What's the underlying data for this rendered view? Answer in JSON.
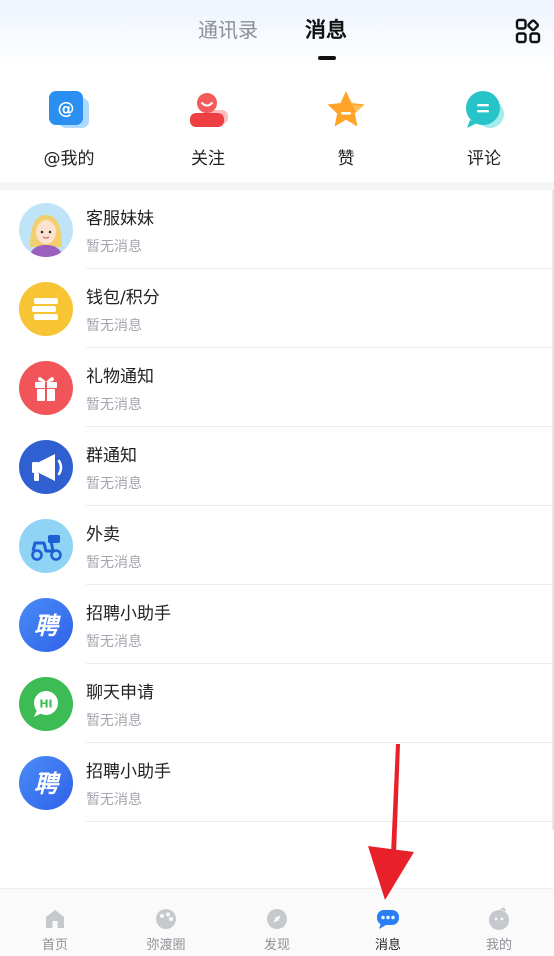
{
  "header": {
    "tabs": [
      {
        "label": "通讯录"
      },
      {
        "label": "消息"
      }
    ]
  },
  "quick_actions": [
    {
      "label": "@我的",
      "icon": "at-mention-icon"
    },
    {
      "label": "关注",
      "icon": "follow-person-icon"
    },
    {
      "label": "赞",
      "icon": "star-like-icon"
    },
    {
      "label": "评论",
      "icon": "comment-bubble-icon"
    }
  ],
  "messages": [
    {
      "title": "客服妹妹",
      "subtitle": "暂无消息",
      "icon": "customer-service-avatar-icon"
    },
    {
      "title": "钱包/积分",
      "subtitle": "暂无消息",
      "icon": "wallet-icon"
    },
    {
      "title": "礼物通知",
      "subtitle": "暂无消息",
      "icon": "gift-icon"
    },
    {
      "title": "群通知",
      "subtitle": "暂无消息",
      "icon": "megaphone-icon"
    },
    {
      "title": "外卖",
      "subtitle": "暂无消息",
      "icon": "scooter-icon"
    },
    {
      "title": "招聘小助手",
      "subtitle": "暂无消息",
      "icon": "recruit-icon",
      "badge_text": "聘"
    },
    {
      "title": "聊天申请",
      "subtitle": "暂无消息",
      "icon": "chat-hi-icon",
      "badge_text": "HI"
    },
    {
      "title": "招聘小助手",
      "subtitle": "暂无消息",
      "icon": "recruit-icon",
      "badge_text": "聘"
    }
  ],
  "bottom_nav": {
    "items": [
      {
        "label": "首页",
        "icon": "home-icon"
      },
      {
        "label": "弥渡圈",
        "icon": "circle-community-icon"
      },
      {
        "label": "发现",
        "icon": "discover-icon"
      },
      {
        "label": "消息",
        "icon": "message-icon",
        "active": true
      },
      {
        "label": "我的",
        "icon": "profile-icon"
      }
    ]
  },
  "colors": {
    "accent_blue": "#2a7ef5",
    "list_subtitle": "#a3a7ad",
    "annotation_arrow": "#e8202a"
  }
}
